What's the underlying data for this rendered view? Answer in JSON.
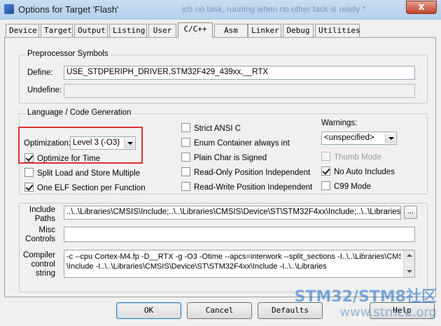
{
  "window": {
    "title": "Options for Target 'Flash'",
    "title_ghost": "ich no task, running when no other task is ready *",
    "close_label": "x"
  },
  "tabs": [
    "Device",
    "Target",
    "Output",
    "Listing",
    "User",
    "C/C++",
    "Asm",
    "Linker",
    "Debug",
    "Utilities"
  ],
  "active_tab": "C/C++",
  "preprocessor": {
    "group_label": "Preprocessor Symbols",
    "define_label": "Define:",
    "define_value": "USE_STDPERIPH_DRIVER,STM32F429_439xx,__RTX",
    "undefine_label": "Undefine:",
    "undefine_value": ""
  },
  "language": {
    "group_label": "Language / Code Generation",
    "optimization_label": "Optimization:",
    "optimization_value": "Level 3 (-O3)",
    "optimize_for_time": "Optimize for Time",
    "split_load_store": "Split Load and Store Multiple",
    "one_elf_section": "One ELF Section per Function",
    "strict_ansi": "Strict ANSI C",
    "enum_container": "Enum Container always int",
    "plain_char": "Plain Char is Signed",
    "ropi": "Read-Only Position Independent",
    "rwpi": "Read-Write Position Independent",
    "warnings_label": "Warnings:",
    "warnings_value": "<unspecified>",
    "thumb_mode": "Thumb Mode",
    "no_auto_includes": "No Auto Includes",
    "c99_mode": "C99 Mode"
  },
  "include": {
    "label": "Include Paths",
    "value": "..\\..\\Libraries\\CMSIS\\Include;..\\..\\Libraries\\CMSIS\\Device\\ST\\STM32F4xx\\Include;..\\..\\Libraries\\S",
    "browse": "..."
  },
  "misc": {
    "label": "Misc Controls",
    "value": ""
  },
  "compiler": {
    "label": "Compiler control string",
    "line1": "-c --cpu Cortex-M4.fp -D__RTX -g -O3 -Otime --apcs=interwork --split_sections -I..\\..\\Libraries\\CMSIS",
    "line2": "\\Include -I..\\..\\Libraries\\CMSIS\\Device\\ST\\STM32F4xx\\Include -I..\\..\\Libraries"
  },
  "buttons": {
    "ok": "OK",
    "cancel": "Cancel",
    "defaults": "Defaults",
    "help": "Help"
  },
  "watermark": {
    "logo": "STM32/STM8社区",
    "url": "www.stmcu.org"
  },
  "colors": {
    "highlight": "#e03030",
    "titlebar": "#b7d0ec"
  }
}
